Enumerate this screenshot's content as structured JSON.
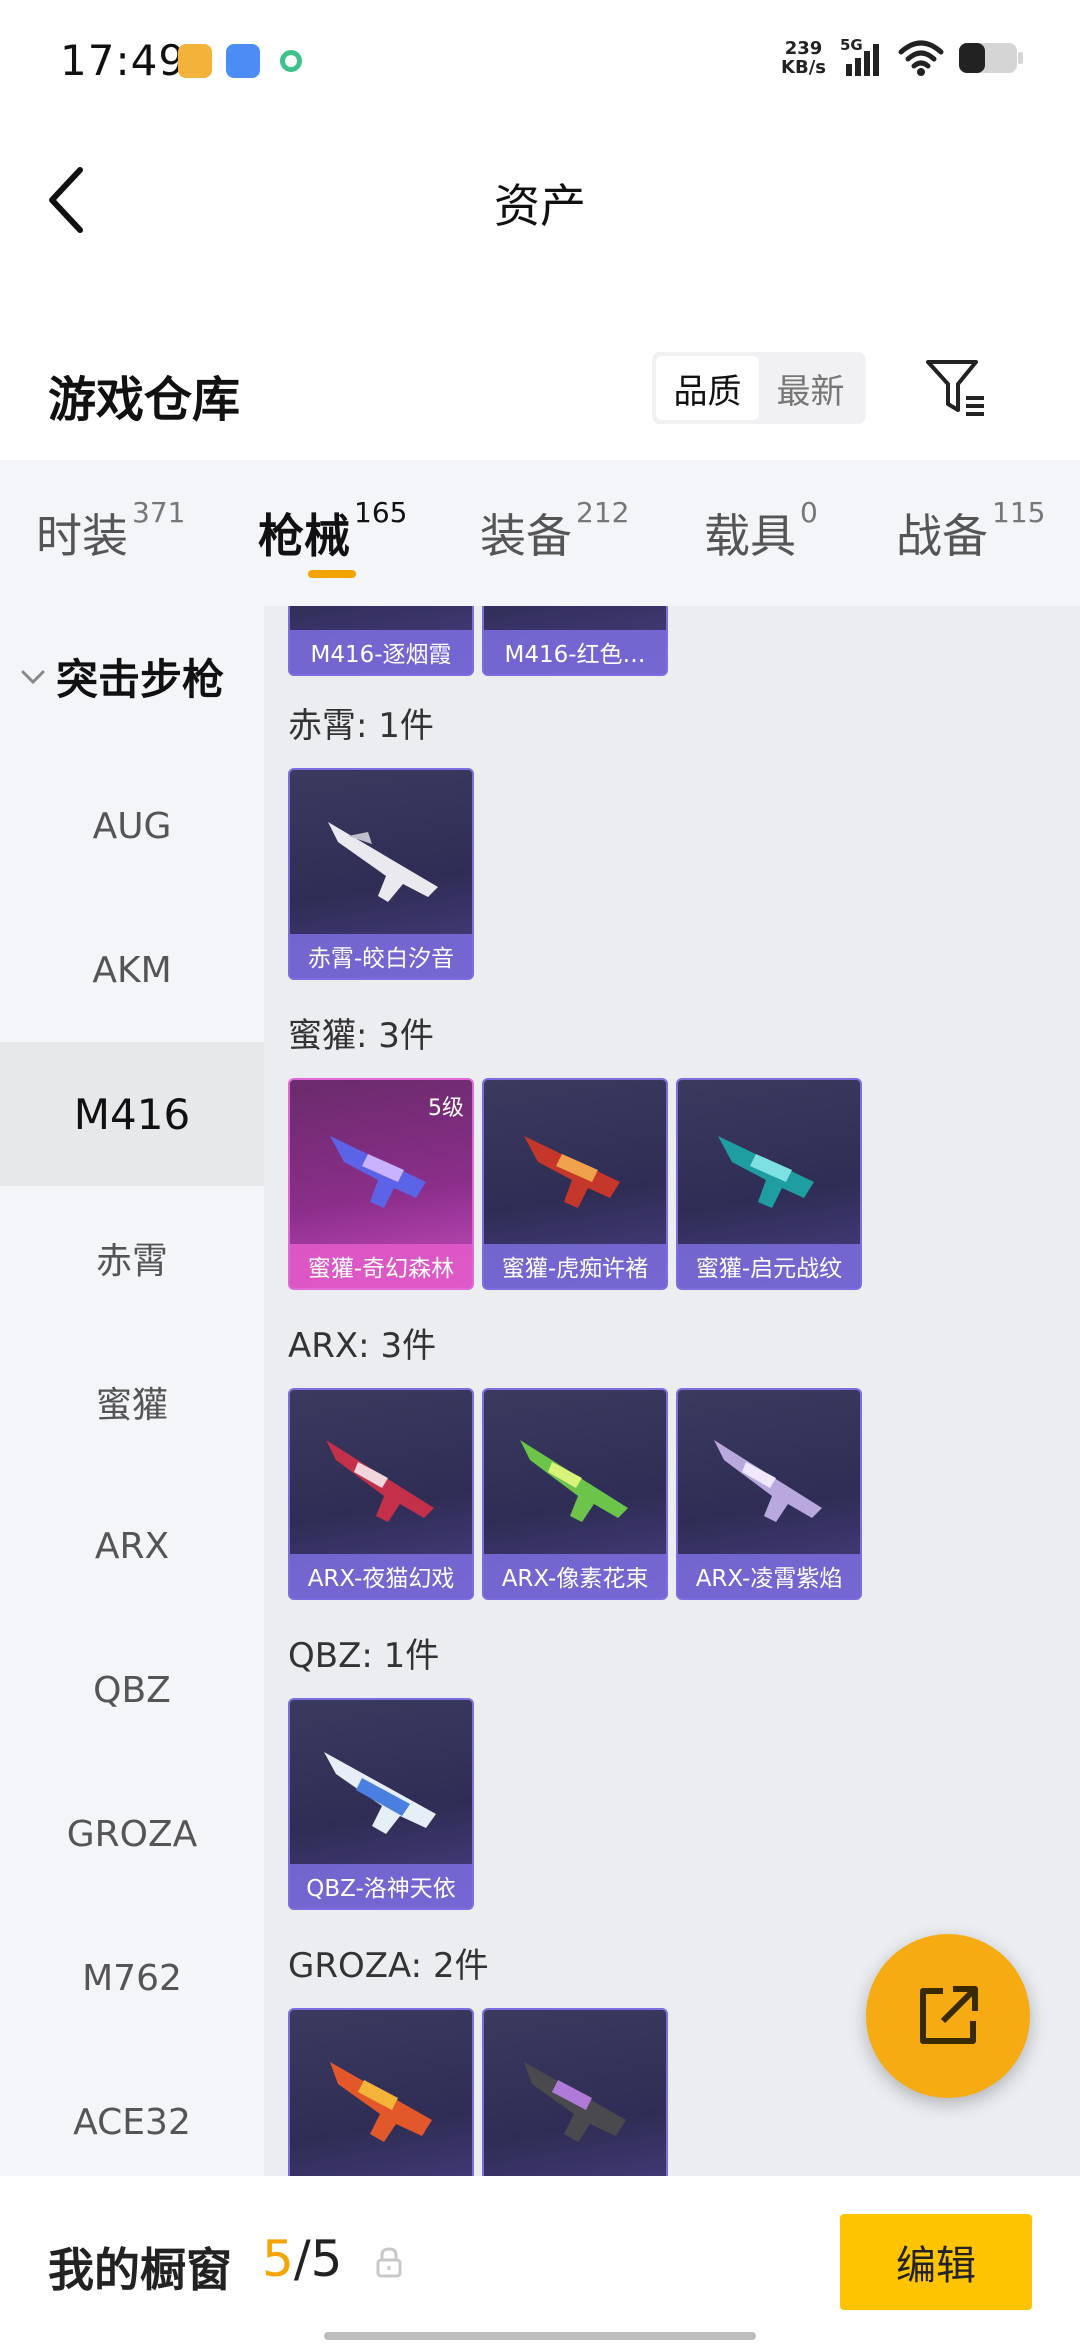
{
  "status_bar": {
    "time": "17:49",
    "net_speed_value": "239",
    "net_speed_unit": "KB/s",
    "network": "5G",
    "icons": [
      "app-orange-icon",
      "app-blue-icon",
      "app-green-icon",
      "signal-icon",
      "wifi-icon",
      "battery-icon"
    ]
  },
  "header": {
    "title": "资产"
  },
  "warehouse": {
    "title": "游戏仓库",
    "sort_options": [
      "品质",
      "最新"
    ],
    "active_sort": "品质"
  },
  "categories": [
    {
      "label": "时装",
      "count": "371"
    },
    {
      "label": "枪械",
      "count": "165",
      "active": true
    },
    {
      "label": "装备",
      "count": "212"
    },
    {
      "label": "载具",
      "count": "0"
    },
    {
      "label": "战备",
      "count": "115"
    }
  ],
  "sidebar": {
    "group": "突击步枪",
    "items": [
      "AUG",
      "AKM",
      "M416",
      "赤霄",
      "蜜獾",
      "ARX",
      "QBZ",
      "GROZA",
      "M762",
      "ACE32"
    ],
    "active": "M416"
  },
  "main": {
    "top_partial_cards": [
      "M416-逐烟霞",
      "M416-红色…"
    ],
    "groups": [
      {
        "label": "赤霄: 1件",
        "items": [
          {
            "name": "赤霄-皎白汐音"
          }
        ]
      },
      {
        "label": "蜜獾: 3件",
        "items": [
          {
            "name": "蜜獾-奇幻森林",
            "level": "5级"
          },
          {
            "name": "蜜獾-虎痴许褚"
          },
          {
            "name": "蜜獾-启元战纹"
          }
        ]
      },
      {
        "label": "ARX: 3件",
        "items": [
          {
            "name": "ARX-夜猫幻戏"
          },
          {
            "name": "ARX-像素花束"
          },
          {
            "name": "ARX-凌霄紫焰"
          }
        ]
      },
      {
        "label": "QBZ: 1件",
        "items": [
          {
            "name": "QBZ-洛神天依"
          }
        ]
      },
      {
        "label": "GROZA: 2件",
        "items": [
          {
            "name": ""
          },
          {
            "name": ""
          }
        ]
      }
    ]
  },
  "bottom_bar": {
    "title": "我的橱窗",
    "current": "5",
    "total": "/5",
    "edit_label": "编辑"
  },
  "colors": {
    "accent": "#f5a300",
    "edit_button": "#ffc400",
    "fab": "#f7ab12",
    "card_border": "#7c6ee0",
    "card_highlight": "#e06ad5"
  }
}
